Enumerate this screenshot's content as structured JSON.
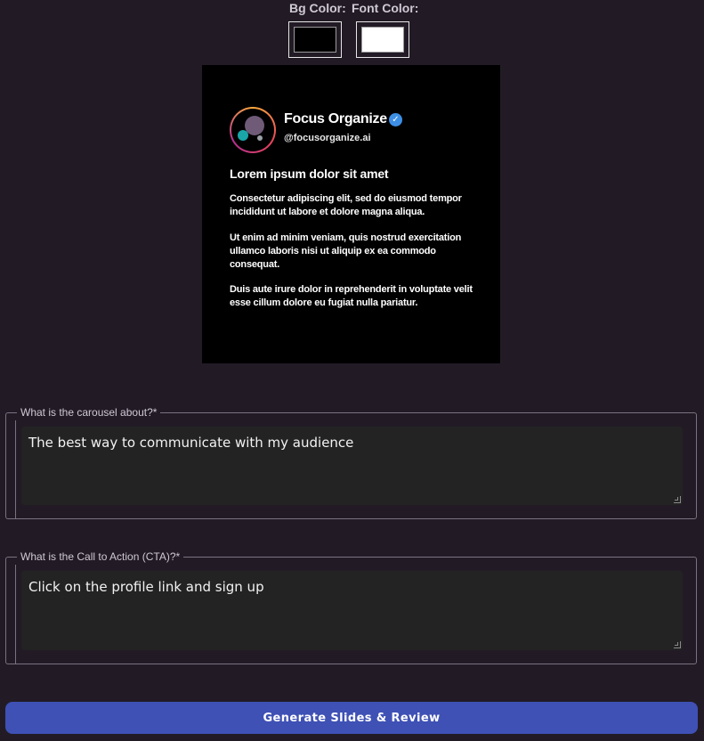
{
  "pickers": {
    "bg_label": "Bg Color:",
    "font_label": "Font Color:",
    "bg_value": "#000000",
    "font_value": "#ffffff"
  },
  "preview": {
    "brand_name": "Focus Organize",
    "verified_icon": "verified-badge-icon",
    "handle": "@focusorganize.ai",
    "title": "Lorem ipsum dolor sit amet",
    "paragraphs": [
      "Consectetur adipiscing elit, sed do eiusmod tempor incididunt ut labore et dolore magna aliqua.",
      "Ut enim ad minim veniam, quis nostrud exercitation ullamco laboris nisi ut aliquip ex ea commodo consequat.",
      "Duis aute irure dolor in reprehenderit in voluptate velit esse cillum dolore eu fugiat nulla pariatur."
    ]
  },
  "topic_field": {
    "label": "What is the carousel about?*",
    "value": "The best way to communicate with my audience"
  },
  "cta_field": {
    "label": "What is the Call to Action (CTA)?*",
    "value": "Click on the profile link and sign up"
  },
  "generate_button": {
    "label": "Generate Slides & Review"
  },
  "colors": {
    "background": "#221b26",
    "accent": "#3f51b5",
    "verified": "#3d8fe6"
  }
}
